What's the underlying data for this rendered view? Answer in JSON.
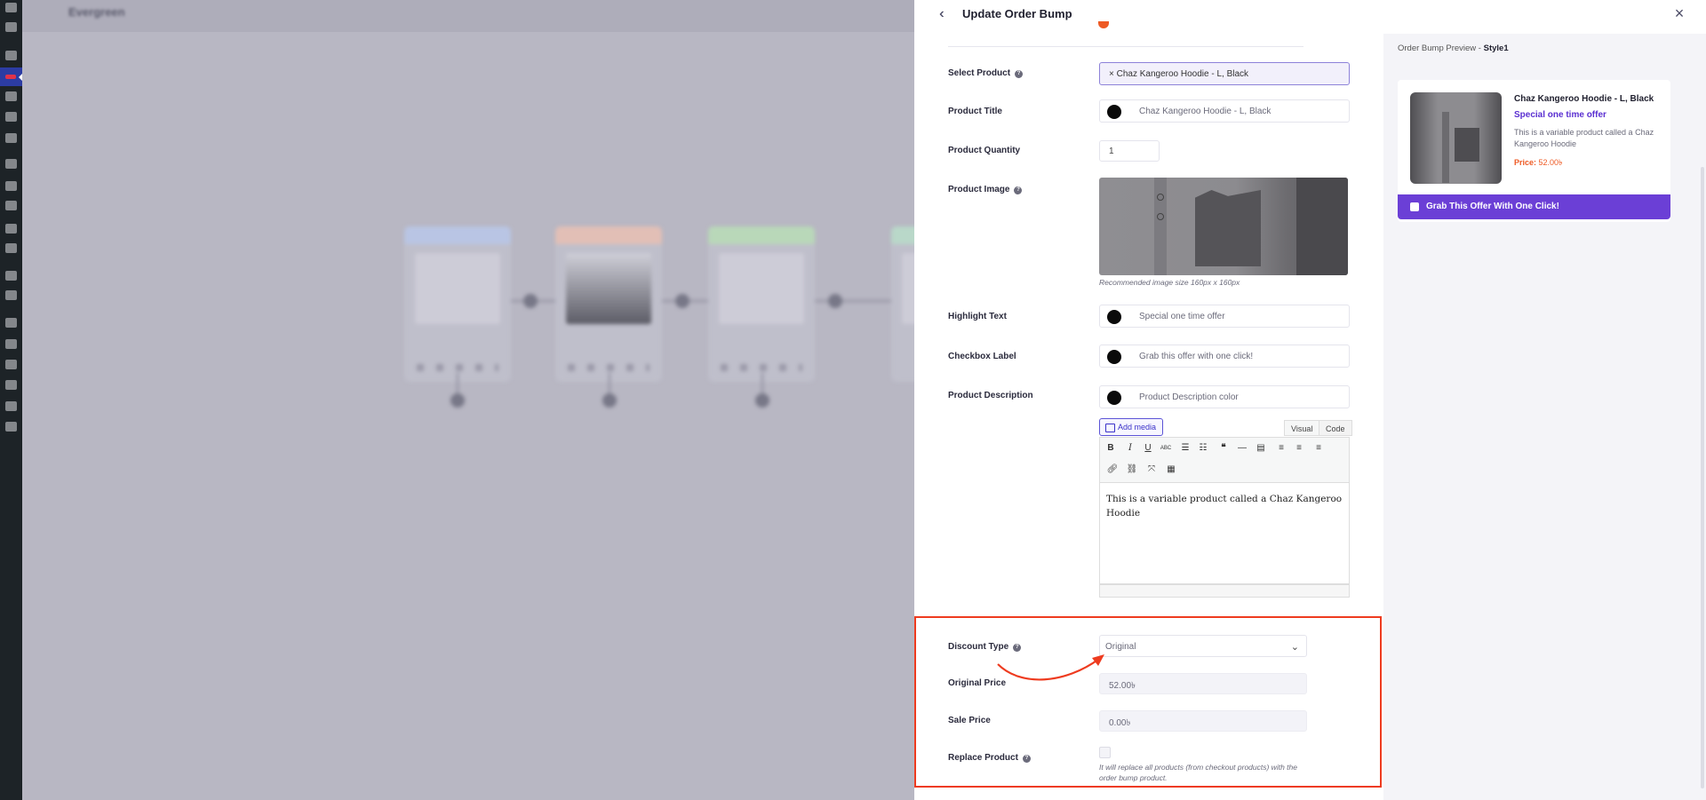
{
  "canvas": {
    "breadcrumb": "Evergreen"
  },
  "drawer": {
    "title": "Update Order Bump",
    "fields": {
      "select_product": {
        "label": "Select Product",
        "value": "× Chaz Kangeroo Hoodie -  L,  Black"
      },
      "product_title": {
        "label": "Product Title",
        "value": "Chaz Kangeroo Hoodie -  L,  Black"
      },
      "product_quantity": {
        "label": "Product Quantity",
        "value": "1"
      },
      "product_image": {
        "label": "Product Image",
        "note": "Recommended image size 160px x 160px"
      },
      "highlight_text": {
        "label": "Highlight Text",
        "value": "Special one time offer"
      },
      "checkbox_label": {
        "label": "Checkbox Label",
        "value": "Grab this offer with one click!"
      },
      "product_description": {
        "label": "Product Description",
        "value": "Product Description color"
      }
    },
    "editor": {
      "add_media": "Add media",
      "tab_visual": "Visual",
      "tab_code": "Code",
      "content": "This is a variable product called a Chaz Kangeroo Hoodie"
    },
    "pricing": {
      "discount_type": {
        "label": "Discount Type",
        "value": "Original"
      },
      "original_price": {
        "label": "Original Price",
        "value": "52.00৳"
      },
      "sale_price": {
        "label": "Sale Price",
        "value": "0.00৳"
      },
      "replace_product": {
        "label": "Replace Product",
        "note": "It will replace all products (from checkout products) with the order bump product."
      }
    }
  },
  "preview": {
    "title_prefix": "Order Bump Preview -",
    "title_style": "Style1",
    "product_name": "Chaz Kangeroo Hoodie - L, Black",
    "highlight": "Special one time offer",
    "description": "This is a variable product called a Chaz Kangeroo Hoodie",
    "price_label": "Price:",
    "price_value": "52.00৳",
    "button_label": "Grab This Offer With One Click!"
  },
  "colors": {
    "accent": "#6b3fd6",
    "highlight_border": "#ee3b1f",
    "price": "#ee5a24"
  }
}
